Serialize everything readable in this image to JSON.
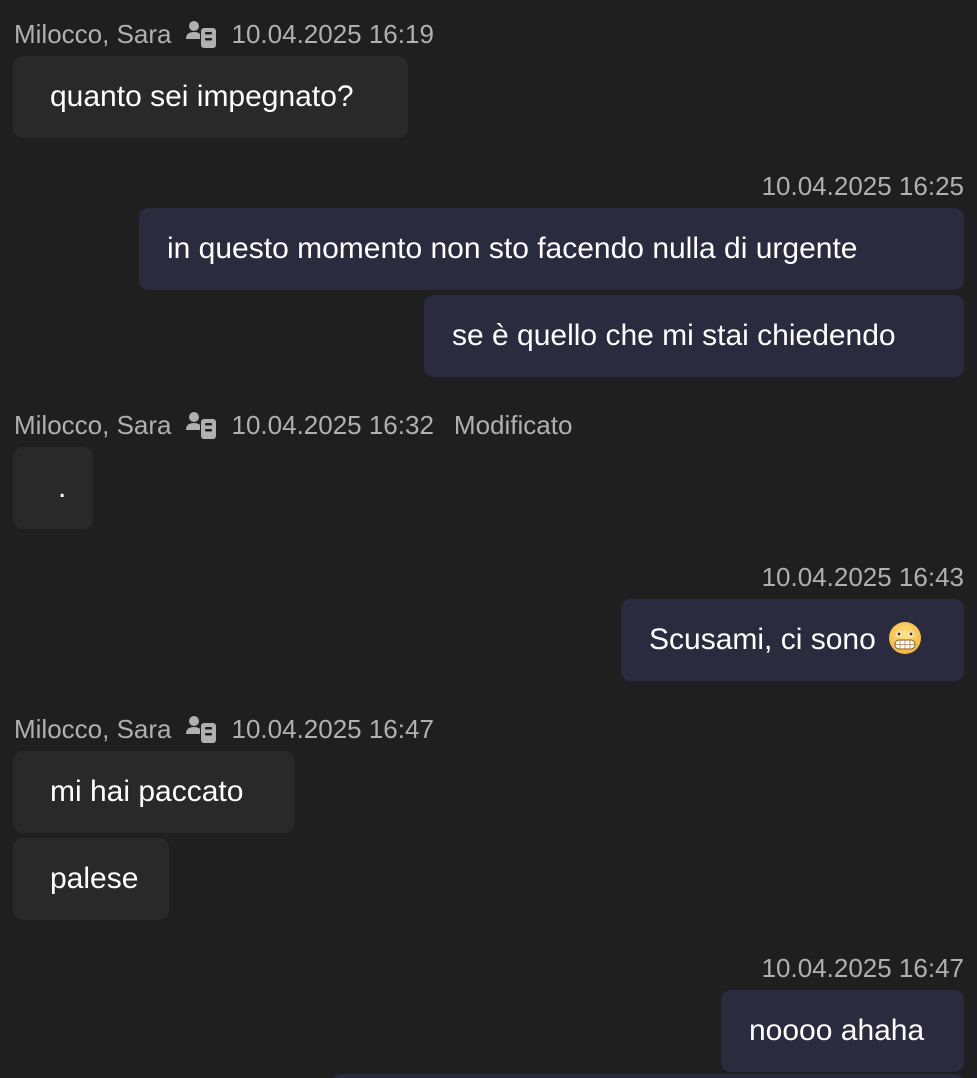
{
  "messages": [
    {
      "direction": "in",
      "sender": "Milocco, Sara",
      "sender_icon": "org-member-icon",
      "timestamp": "10.04.2025 16:19",
      "edited": "",
      "texts": [
        "quanto sei impegnato?"
      ]
    },
    {
      "direction": "out",
      "timestamp": "10.04.2025 16:25",
      "texts": [
        "in questo momento non sto facendo nulla di urgente",
        "se è quello che mi stai chiedendo"
      ]
    },
    {
      "direction": "in",
      "sender": "Milocco, Sara",
      "sender_icon": "org-member-icon",
      "timestamp": "10.04.2025 16:32",
      "edited": "Modificato",
      "texts": [
        "."
      ]
    },
    {
      "direction": "out",
      "timestamp": "10.04.2025 16:43",
      "texts": [
        "Scusami, ci sono"
      ],
      "emoji": "grimacing-face-emoji"
    },
    {
      "direction": "in",
      "sender": "Milocco, Sara",
      "sender_icon": "org-member-icon",
      "timestamp": "10.04.2025 16:47",
      "edited": "",
      "texts": [
        "mi hai paccato",
        "palese"
      ]
    },
    {
      "direction": "out",
      "timestamp": "10.04.2025 16:47",
      "texts": [
        "noooo ahaha"
      ]
    }
  ],
  "colors": {
    "background": "#1f1f1f",
    "incoming_bubble": "#292929",
    "outgoing_bubble": "#2b2b40",
    "meta_text": "#b0b0b0",
    "message_text": "#ffffff"
  }
}
